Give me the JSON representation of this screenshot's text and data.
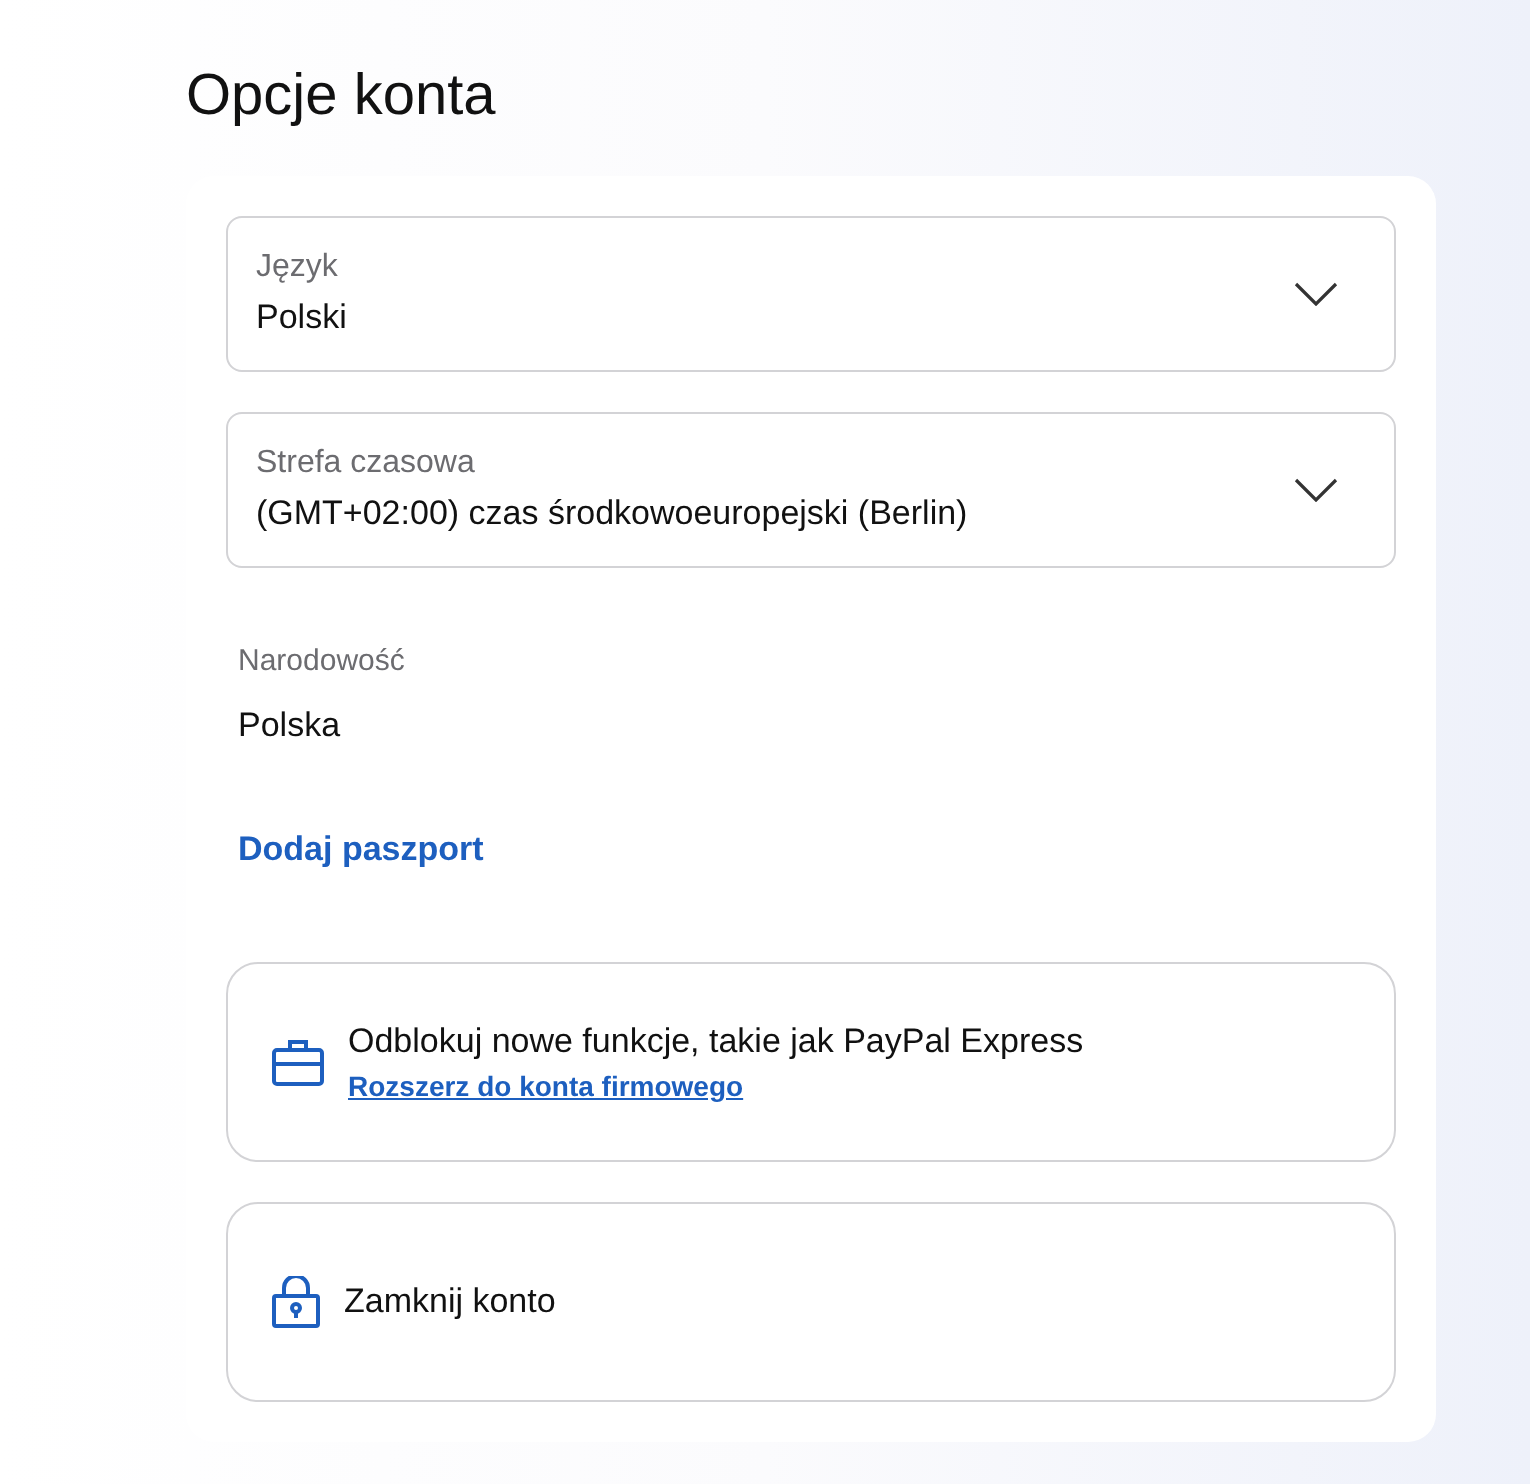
{
  "title": "Opcje konta",
  "selects": [
    {
      "label": "Język",
      "value": "Polski"
    },
    {
      "label": "Strefa czasowa",
      "value": "(GMT+02:00) czas środkowoeuropejski (Berlin)"
    }
  ],
  "nationality": {
    "label": "Narodowość",
    "value": "Polska"
  },
  "add_passport_link": "Dodaj paszport",
  "actions": [
    {
      "kind": "briefcase",
      "text": "Odblokuj nowe funkcje, takie jak PayPal Express",
      "link": "Rozszerz do konta firmowego"
    },
    {
      "kind": "lock",
      "text": "Zamknij konto"
    }
  ]
}
